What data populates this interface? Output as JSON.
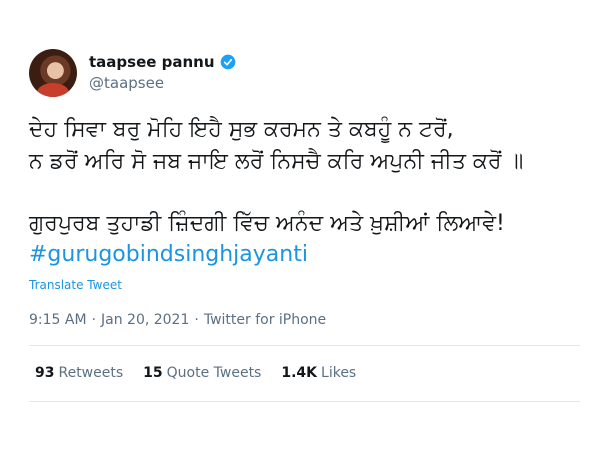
{
  "author": {
    "display_name": "taapsee pannu",
    "handle": "@taapsee",
    "verified": true
  },
  "tweet": {
    "line1": "ਦੇਹ ਸਿਵਾ ਬਰੁ ਮੋਹਿ ਇਹੈ ਸੁਭ ਕਰਮਨ ਤੇ ਕਬਹੂੰ ਨ ਟਰੋਂ,",
    "line2": "ਨ ਡਰੋਂ ਅਰਿ ਸੋ ਜਬ ਜਾਇ ਲਰੋਂ ਨਿਸਚੈ ਕਰਿ ਅਪੁਨੀ ਜੀਤ ਕਰੋਂ ॥",
    "line3": "ਗੁਰਪੁਰਬ ਤੁਹਾਡੀ ਜ਼ਿੰਦਗੀ ਵਿੱਚ ਅਨੰਦ ਅਤੇ ਖ਼ੁਸ਼ੀਆਂ ਲਿਆਵੇ!",
    "hashtag": "#gurugobindsinghjayanti",
    "translate_label": "Translate Tweet",
    "time": "9:15 AM",
    "separator": "·",
    "date": "Jan 20, 2021",
    "source": "Twitter for iPhone"
  },
  "stats": {
    "retweets": {
      "count": "93",
      "label": "Retweets"
    },
    "quote_tweets": {
      "count": "15",
      "label": "Quote Tweets"
    },
    "likes": {
      "count": "1.4K",
      "label": "Likes"
    }
  },
  "colors": {
    "link": "#1b95e0",
    "verified": "#1da1f2",
    "secondary_text": "#5b7083"
  },
  "icons": [
    "verified-badge-icon"
  ]
}
